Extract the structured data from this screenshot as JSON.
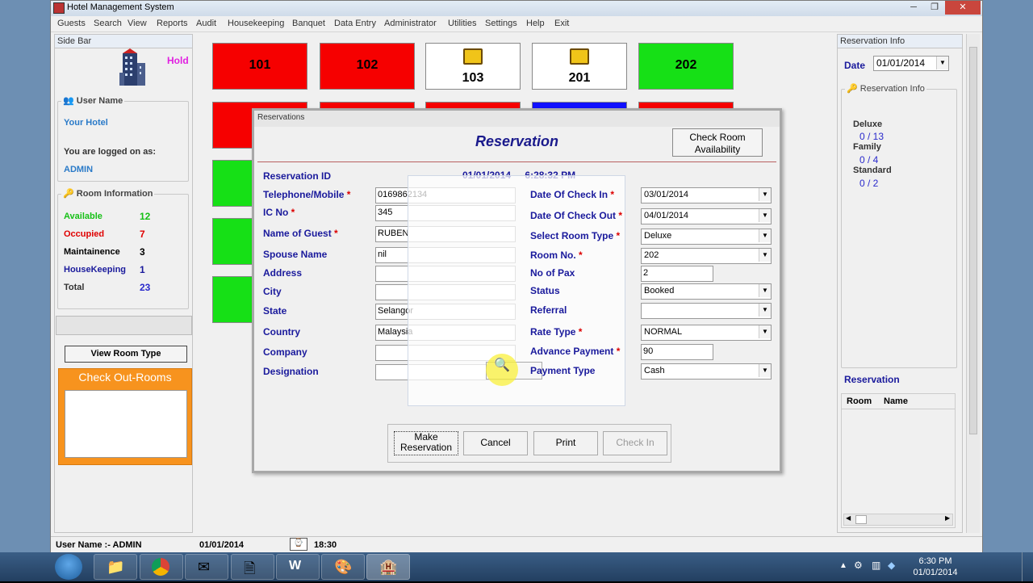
{
  "app": {
    "title": "Hotel Management System"
  },
  "window_controls": {
    "minimize": "─",
    "maximize": "❐",
    "close": "✕"
  },
  "menu": [
    "Guests",
    "Search",
    "View",
    "Reports",
    "Audit",
    "Housekeeping",
    "Banquet",
    "Data Entry",
    "Administrator",
    "Utilities",
    "Settings",
    "Help",
    "Exit"
  ],
  "sidebar": {
    "header": "Side Bar",
    "hold": "Hold",
    "user_group": "User Name",
    "hotel": "Your Hotel",
    "logged_label": "You are logged on as:",
    "user": "ADMIN",
    "room_info_title": "Room Information",
    "stats": [
      {
        "label": "Available",
        "value": "12",
        "color": "#16c016",
        "valcolor": "#16c016"
      },
      {
        "label": "Occupied",
        "value": "7",
        "color": "#e00000",
        "valcolor": "#e00000"
      },
      {
        "label": "Maintainence",
        "value": "3",
        "color": "#000000",
        "valcolor": "#000000"
      },
      {
        "label": "HouseKeeping",
        "value": "1",
        "color": "#1a1a9c",
        "valcolor": "#1a1a9c"
      },
      {
        "label": "Total",
        "value": "23",
        "color": "#333333",
        "valcolor": "#2a2acc"
      }
    ],
    "view_room_type": "View Room Type",
    "checkout_title": "Check Out-Rooms"
  },
  "rooms_row1": [
    {
      "number": "101",
      "color": "red",
      "icon": false
    },
    {
      "number": "102",
      "color": "red",
      "icon": false
    },
    {
      "number": "103",
      "color": "white",
      "icon": true
    },
    {
      "number": "201",
      "color": "white",
      "icon": true
    },
    {
      "number": "202",
      "color": "green",
      "icon": false
    }
  ],
  "dialog": {
    "window_title": "Reservations",
    "title": "Reservation",
    "check_room_btn": "Check Room Availability",
    "reservation_id_label": "Reservation ID",
    "date": "01/01/2014",
    "time": "6:28:32 PM",
    "left_fields": [
      {
        "label": "Telephone/Mobile",
        "req": true,
        "value": "0169862134"
      },
      {
        "label": "IC No",
        "req": true,
        "value": "345"
      },
      {
        "label": "Name of Guest",
        "req": true,
        "value": "RUBEN"
      },
      {
        "label": "Spouse Name",
        "req": false,
        "value": "nil"
      },
      {
        "label": "Address",
        "req": false,
        "value": ""
      },
      {
        "label": "City",
        "req": false,
        "value": ""
      },
      {
        "label": "State",
        "req": false,
        "value": "Selangor"
      },
      {
        "label": "Country",
        "req": false,
        "value": "Malaysia"
      },
      {
        "label": "Company",
        "req": false,
        "value": ""
      },
      {
        "label": "Designation",
        "req": false,
        "value": ""
      }
    ],
    "right_fields": [
      {
        "label": "Date Of Check In",
        "req": true,
        "value": "03/01/2014",
        "kind": "combo"
      },
      {
        "label": "Date Of Check Out",
        "req": true,
        "value": "04/01/2014",
        "kind": "combo"
      },
      {
        "label": "Select Room Type",
        "req": true,
        "value": "Deluxe",
        "kind": "combo"
      },
      {
        "label": "Room No.",
        "req": true,
        "value": "202",
        "kind": "combo"
      },
      {
        "label": "No of Pax",
        "req": false,
        "value": "2",
        "kind": "text"
      },
      {
        "label": "Status",
        "req": false,
        "value": "Booked",
        "kind": "combo"
      },
      {
        "label": "Referral",
        "req": false,
        "value": "",
        "kind": "combo"
      },
      {
        "label": "Rate Type",
        "req": true,
        "value": "NORMAL",
        "kind": "combo"
      },
      {
        "label": "Advance Payment",
        "req": true,
        "value": "90",
        "kind": "text"
      },
      {
        "label": "Payment Type",
        "req": false,
        "value": "Cash",
        "kind": "combo"
      }
    ],
    "buttons": [
      "Make Reservation",
      "Cancel",
      "Print",
      "Check In"
    ]
  },
  "right_panel": {
    "header": "Reservation Info",
    "date_label": "Date",
    "date_value": "01/01/2014",
    "info_title": "Reservation Info",
    "types": [
      {
        "name": "Deluxe",
        "value": "0 / 13"
      },
      {
        "name": "Family",
        "value": "0 / 4"
      },
      {
        "name": "Standard",
        "value": "0 / 2"
      }
    ],
    "reservation_title": "Reservation",
    "col_room": "Room",
    "col_name": "Name"
  },
  "status_bar": {
    "user": "User Name :- ADMIN",
    "date": "01/01/2014",
    "time": "18:30"
  },
  "taskbar": {
    "time": "6:30 PM",
    "date": "01/01/2014"
  }
}
